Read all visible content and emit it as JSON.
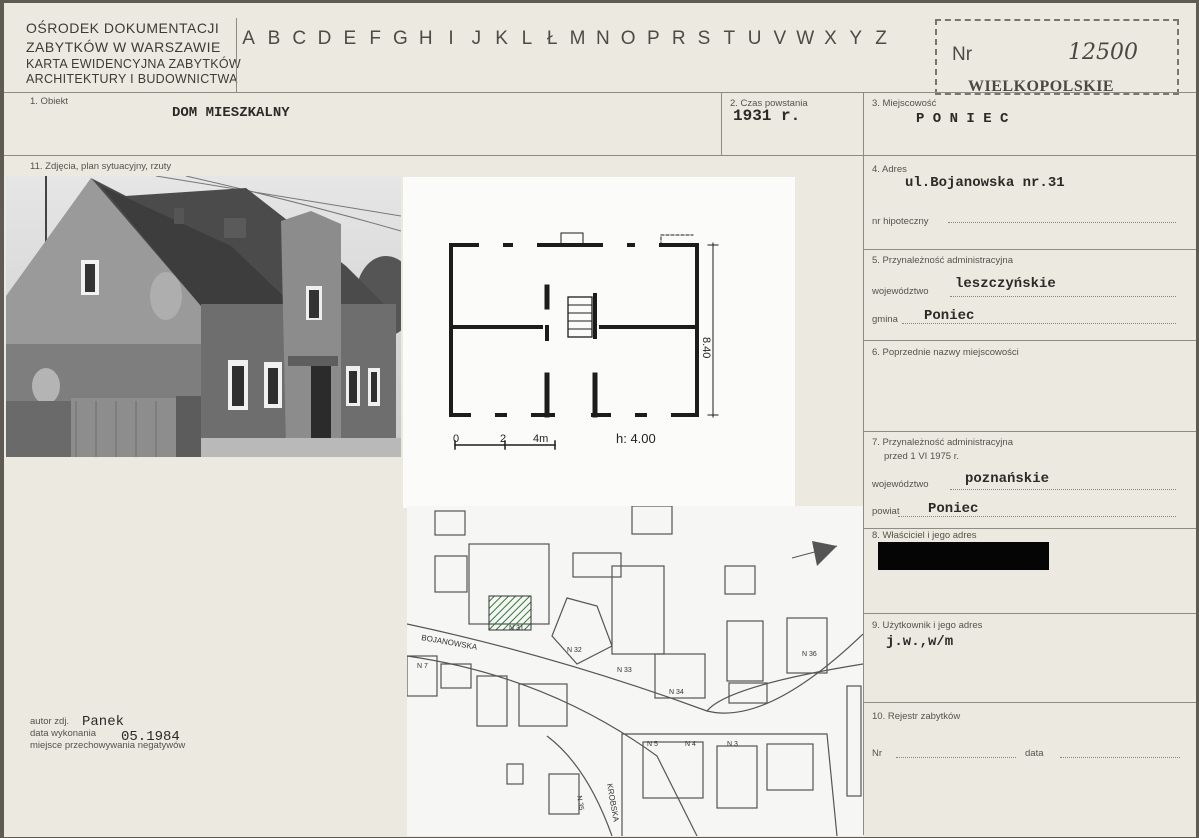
{
  "header": {
    "institution_lines": [
      "OŚRODEK DOKUMENTACJI",
      "ZABYTKÓW W WARSZAWIE",
      "KARTA EWIDENCYJNA ZABYTKÓW",
      "ARCHITEKTURY I BUDOWNICTWA"
    ],
    "alphabet": [
      "A",
      "B",
      "C",
      "D",
      "E",
      "F",
      "G",
      "H",
      "I",
      "J",
      "K",
      "L",
      "Ł",
      "M",
      "N",
      "O",
      "P",
      "R",
      "S",
      "T",
      "U",
      "V",
      "W",
      "X",
      "Y",
      "Z"
    ],
    "nr_label": "Nr",
    "nr_value": "12500",
    "region_stamp": "WIELKOPOLSKIE"
  },
  "fields": {
    "obiekt": {
      "label": "1. Obiekt",
      "value": "DOM MIESZKALNY"
    },
    "czas": {
      "label": "2. Czas powstania",
      "value": "1931 r."
    },
    "miejscowosc": {
      "label": "3. Miejscowość",
      "value": "P O N I E C"
    },
    "adres": {
      "label": "4. Adres",
      "value": "ul.Bojanowska nr.31"
    },
    "hipoteczny": {
      "label": "nr hipoteczny"
    },
    "przynaleznosc": {
      "label": "5. Przynależność administracyjna",
      "woj_label": "województwo",
      "woj_value": "leszczyńskie",
      "gmina_label": "gmina",
      "gmina_value": "Poniec"
    },
    "poprzednie": {
      "label": "6. Poprzednie nazwy miejscowości"
    },
    "przynaleznosc_1975": {
      "label": "7. Przynależność administracyjna",
      "label2": "przed 1 VI 1975 r.",
      "woj_label": "województwo",
      "woj_value": "poznańskie",
      "powiat_label": "powiat",
      "powiat_value": "Poniec"
    },
    "wlasciciel": {
      "label": "8. Właściciel i jego adres"
    },
    "uzytkownik": {
      "label": "9. Użytkownik i jego adres",
      "value": "j.w.,w/m"
    },
    "rejestr": {
      "label": "10. Rejestr zabytków",
      "nr_label": "Nr",
      "data_label": "data"
    },
    "zdjecia": {
      "label": "11. Zdjęcia, plan sytuacyjny, rzuty"
    }
  },
  "footer": {
    "autor_label": "autor zdj.",
    "autor_value": "Panek",
    "data_label": "data wykonania",
    "data_value": "05.1984",
    "miejsce_label": "miejsce przechowywania negatywów"
  },
  "plan": {
    "scale_0": "0",
    "scale_mid": "2",
    "scale_end": "4m",
    "height_note": "h: 4.00",
    "dim_side": "8.40"
  },
  "map": {
    "street_1": "BOJANOWSKA",
    "street_2": "KROBSKA",
    "numbers": [
      "N 31",
      "N 32",
      "N 33",
      "N 34",
      "N 36",
      "N 7",
      "N 5",
      "N 4",
      "N 3",
      "N 35"
    ]
  }
}
